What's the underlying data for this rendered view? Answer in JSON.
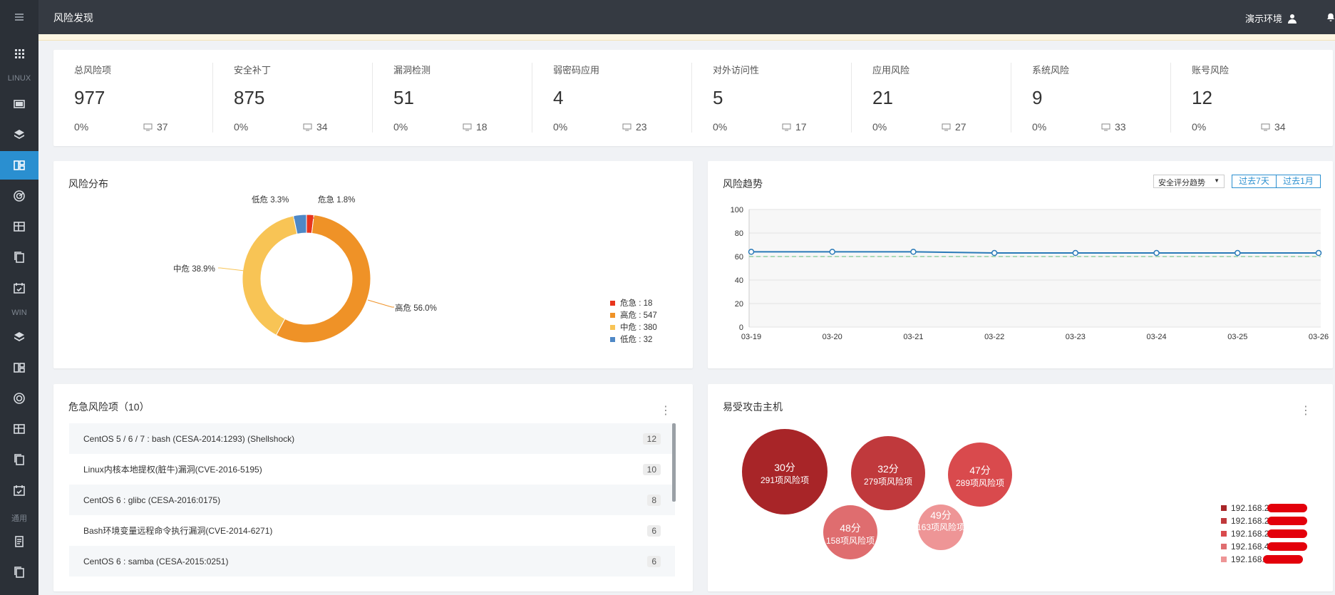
{
  "topbar": {
    "title": "风险发现",
    "env": "演示环境"
  },
  "sidebar": {
    "label_linux": "LINUX",
    "label_win": "WIN",
    "label_common": "通用"
  },
  "stats": [
    {
      "label": "总风险项",
      "value": "977",
      "pct": "0%",
      "hosts": "37"
    },
    {
      "label": "安全补丁",
      "value": "875",
      "pct": "0%",
      "hosts": "34"
    },
    {
      "label": "漏洞检测",
      "value": "51",
      "pct": "0%",
      "hosts": "18"
    },
    {
      "label": "弱密码应用",
      "value": "4",
      "pct": "0%",
      "hosts": "23"
    },
    {
      "label": "对外访问性",
      "value": "5",
      "pct": "0%",
      "hosts": "17"
    },
    {
      "label": "应用风险",
      "value": "21",
      "pct": "0%",
      "hosts": "27"
    },
    {
      "label": "系统风险",
      "value": "9",
      "pct": "0%",
      "hosts": "33"
    },
    {
      "label": "账号风险",
      "value": "12",
      "pct": "0%",
      "hosts": "34"
    }
  ],
  "risk_distribution": {
    "title": "风险分布",
    "slice_labels": [
      "危急 1.8%",
      "高危 56.0%",
      "中危 38.9%",
      "低危 3.3%"
    ],
    "legend": [
      "危急 : 18",
      "高危 : 547",
      "中危 : 380",
      "低危 : 32"
    ]
  },
  "risk_trend": {
    "title": "风险趋势",
    "select_value": "安全评分趋势",
    "btn_7d": "过去7天",
    "btn_1m": "过去1月"
  },
  "critical": {
    "title": "危急风险项（10）",
    "rows": [
      {
        "name": "CentOS 5 / 6 / 7 : bash (CESA-2014:1293) (Shellshock)",
        "count": "12"
      },
      {
        "name": "Linux内核本地提权(脏牛)漏洞(CVE-2016-5195)",
        "count": "10"
      },
      {
        "name": "CentOS 6 : glibc (CESA-2016:0175)",
        "count": "8"
      },
      {
        "name": "Bash环境变量远程命令执行漏洞(CVE-2014-6271)",
        "count": "6"
      },
      {
        "name": "CentOS 6 : samba (CESA-2015:0251)",
        "count": "6"
      }
    ]
  },
  "vulnerable_hosts": {
    "title": "易受攻击主机",
    "bubbles": [
      {
        "score": "30分",
        "items": "291项风险项",
        "color": "#a82528"
      },
      {
        "score": "32分",
        "items": "279项风险项",
        "color": "#c0393c"
      },
      {
        "score": "47分",
        "items": "289项风险项",
        "color": "#d94a4d"
      },
      {
        "score": "48分",
        "items": "158项风险项",
        "color": "#df6d6f"
      },
      {
        "score": "49分",
        "items": "163项风险项",
        "color": "#ee9596"
      }
    ],
    "legend": [
      "192.168.2",
      "192.168.2",
      "192.168.2",
      "192.168.4",
      "192.168."
    ]
  },
  "chart_data": [
    {
      "type": "pie",
      "title": "风险分布",
      "categories": [
        "危急",
        "高危",
        "中危",
        "低危"
      ],
      "values": [
        18,
        547,
        380,
        32
      ],
      "percent": [
        1.8,
        56.0,
        38.9,
        3.3
      ],
      "colors": [
        "#e8341c",
        "#ef9227",
        "#f8c455",
        "#4f88c6"
      ],
      "legend_position": "bottom-right"
    },
    {
      "type": "line",
      "title": "风险趋势",
      "x": [
        "03-19",
        "03-20",
        "03-21",
        "03-22",
        "03-23",
        "03-24",
        "03-25",
        "03-26"
      ],
      "series": [
        {
          "name": "",
          "values": [
            64,
            64,
            64,
            63,
            63,
            63,
            63,
            63
          ],
          "color": "#2a7ab8"
        }
      ],
      "reference": {
        "value": 60,
        "color": "#8fcfa3"
      },
      "ylim": [
        0,
        100
      ],
      "yticks": [
        0,
        20,
        40,
        60,
        80,
        100
      ],
      "grid": true
    }
  ]
}
